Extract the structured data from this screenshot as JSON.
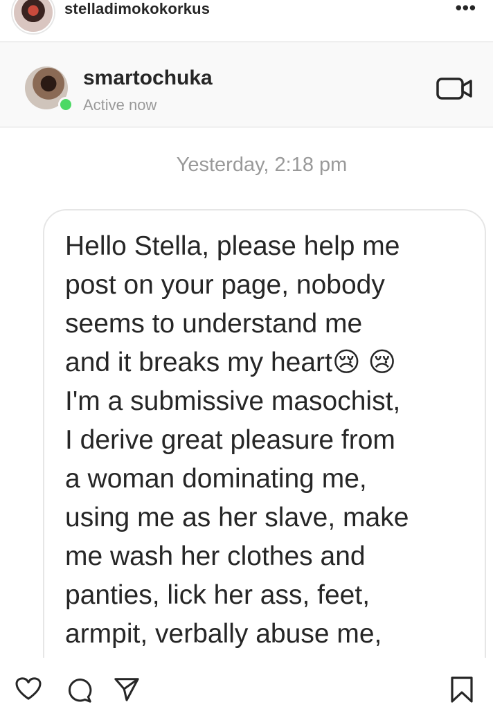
{
  "post": {
    "username": "stelladimokokorkus",
    "more_label": "•••"
  },
  "dm": {
    "contact_name": "smartochuka",
    "status": "Active now",
    "timestamp": "Yesterday, 2:18 pm",
    "message": "Hello Stella, please help me\npost on your page, nobody\nseems to understand me\nand it breaks my heart😢 😢\nI'm a submissive masochist,\nI derive great pleasure from\na woman dominating me,\nusing me as her slave, make\nme wash her clothes and\npanties, lick her ass, feet,\narmpit, verbally abuse me,"
  },
  "icons": {
    "header": [
      "avatar",
      "more-options-icon"
    ],
    "dm_header": [
      "contact-avatar",
      "active-status-dot",
      "video-call-icon"
    ],
    "actions": [
      "like-heart-icon",
      "comment-icon",
      "share-icon",
      "save-bookmark-icon"
    ]
  },
  "colors": {
    "active_green": "#4cd964",
    "muted_text": "#999999",
    "text": "#262626",
    "bubble_border": "#e6e6e6"
  }
}
